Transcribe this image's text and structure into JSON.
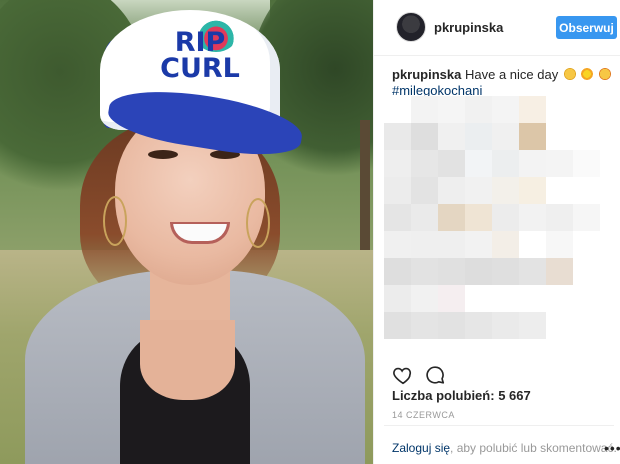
{
  "post": {
    "username": "pkrupinska",
    "follow_label": "Obserwuj",
    "caption_text": "Have a nice day",
    "caption_emojis": [
      "grinning-face-emoji",
      "sun-emoji",
      "kissing-face-emoji"
    ],
    "hashtag": "#milegokochani",
    "likes_label": "Liczba polubień:",
    "likes_count": "5 667",
    "date": "14 CZERWCA",
    "login_link": "Zaloguj się",
    "login_suffix": ", aby polubić lub skomentować.",
    "more_icon": "ellipsis-icon"
  },
  "photo": {
    "cap_logo_line1": "RIP",
    "cap_logo_line2": "CURL",
    "colors": {
      "cap_blue": "#2b44b8",
      "cap_white": "#ffffff",
      "cardigan": "#b8bcc4"
    }
  },
  "comments_blurred": {
    "columns": 8,
    "cells": [
      "#ffffff",
      "#f3f3f3",
      "#f5f5f5",
      "#f1f1f1",
      "#f4f4f4",
      "#f7efe4",
      "#ffffff",
      "#ffffff",
      "#e9e9e9",
      "#dedede",
      "#f0f0f0",
      "#ebeef0",
      "#f0f0f0",
      "#dcc6a8",
      "#ffffff",
      "#ffffff",
      "#eeeeee",
      "#e6e6e6",
      "#e2e2e2",
      "#f2f4f6",
      "#eceeef",
      "#f3f3f3",
      "#f4f4f4",
      "#fafafa",
      "#ececec",
      "#e3e3e3",
      "#eeeeee",
      "#f1f1f1",
      "#f3f0ea",
      "#f6efe2",
      "#ffffff",
      "#ffffff",
      "#e5e5e5",
      "#eaeaea",
      "#e4d6c2",
      "#efe4d4",
      "#ececec",
      "#f2f2f2",
      "#efefef",
      "#f6f6f6",
      "#f0f0f0",
      "#efefef",
      "#efefef",
      "#f2f2f2",
      "#f3eee7",
      "#ffffff",
      "#f7f7f7",
      "#ffffff",
      "#dedede",
      "#e2e2e2",
      "#e0e0e0",
      "#dddddd",
      "#dfdfdf",
      "#e3e3e3",
      "#e8ddd2",
      "#ffffff",
      "#ececec",
      "#f1f1f1",
      "#f5eef0",
      "#ffffff",
      "#ffffff",
      "#ffffff",
      "#ffffff",
      "#ffffff",
      "#e0e0e0",
      "#e4e4e4",
      "#e2e2e2",
      "#e6e6e6",
      "#eaeaea",
      "#ededed",
      "#ffffff",
      "#ffffff"
    ]
  },
  "colors": {
    "accent": "#3897f0",
    "link": "#003569",
    "muted": "#999999",
    "text": "#262626"
  }
}
